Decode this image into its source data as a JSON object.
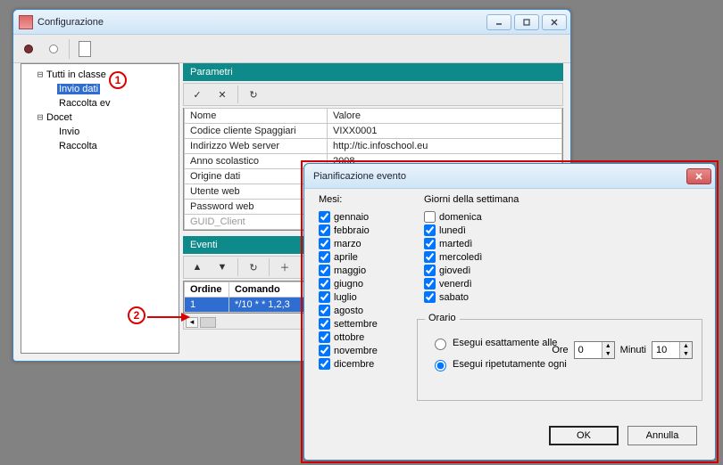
{
  "main_window": {
    "title": "Configurazione"
  },
  "tree": {
    "root1": "Tutti in classe",
    "root1_children": {
      "c1": "Invio dati",
      "c2": "Raccolta ev"
    },
    "root2": "Docet",
    "root2_children": {
      "c1": "Invio",
      "c2": "Raccolta"
    },
    "selected": "Invio dati"
  },
  "annotations": {
    "n1": "1",
    "n2": "2"
  },
  "parametri": {
    "title": "Parametri",
    "headers": {
      "name": "Nome",
      "value": "Valore"
    },
    "rows": [
      {
        "name": "Codice cliente Spaggiari",
        "value": "VIXX0001"
      },
      {
        "name": "Indirizzo Web server",
        "value": "http://tic.infoschool.eu"
      },
      {
        "name": "Anno scolastico",
        "value": "2008"
      },
      {
        "name": "Origine dati",
        "value": ""
      },
      {
        "name": "Utente web",
        "value": ""
      },
      {
        "name": "Password web",
        "value": ""
      },
      {
        "name": "GUID_Client",
        "value": ""
      }
    ]
  },
  "eventi": {
    "title": "Eventi",
    "headers": {
      "ord": "Ordine",
      "cmd": "Comando"
    },
    "row": {
      "ord": "1",
      "cmd": "*/10 * * 1,2,3"
    }
  },
  "dialog": {
    "title": "Pianificazione evento",
    "labels": {
      "mesi": "Mesi:",
      "giorni": "Giorni della settimana",
      "orario": "Orario",
      "exact": "Esegui esattamente alle",
      "repeat": "Esegui ripetutamente ogni",
      "ore": "Ore",
      "minuti": "Minuti",
      "ok": "OK",
      "cancel": "Annulla"
    },
    "months": [
      "gennaio",
      "febbraio",
      "marzo",
      "aprile",
      "maggio",
      "giugno",
      "luglio",
      "agosto",
      "settembre",
      "ottobre",
      "novembre",
      "dicembre"
    ],
    "days": [
      "domenica",
      "lunedì",
      "martedì",
      "mercoledì",
      "giovedì",
      "venerdì",
      "sabato"
    ],
    "days_checked": [
      false,
      true,
      true,
      true,
      true,
      true,
      true
    ],
    "ore_value": "0",
    "minuti_value": "10",
    "orario_mode": "repeat"
  }
}
